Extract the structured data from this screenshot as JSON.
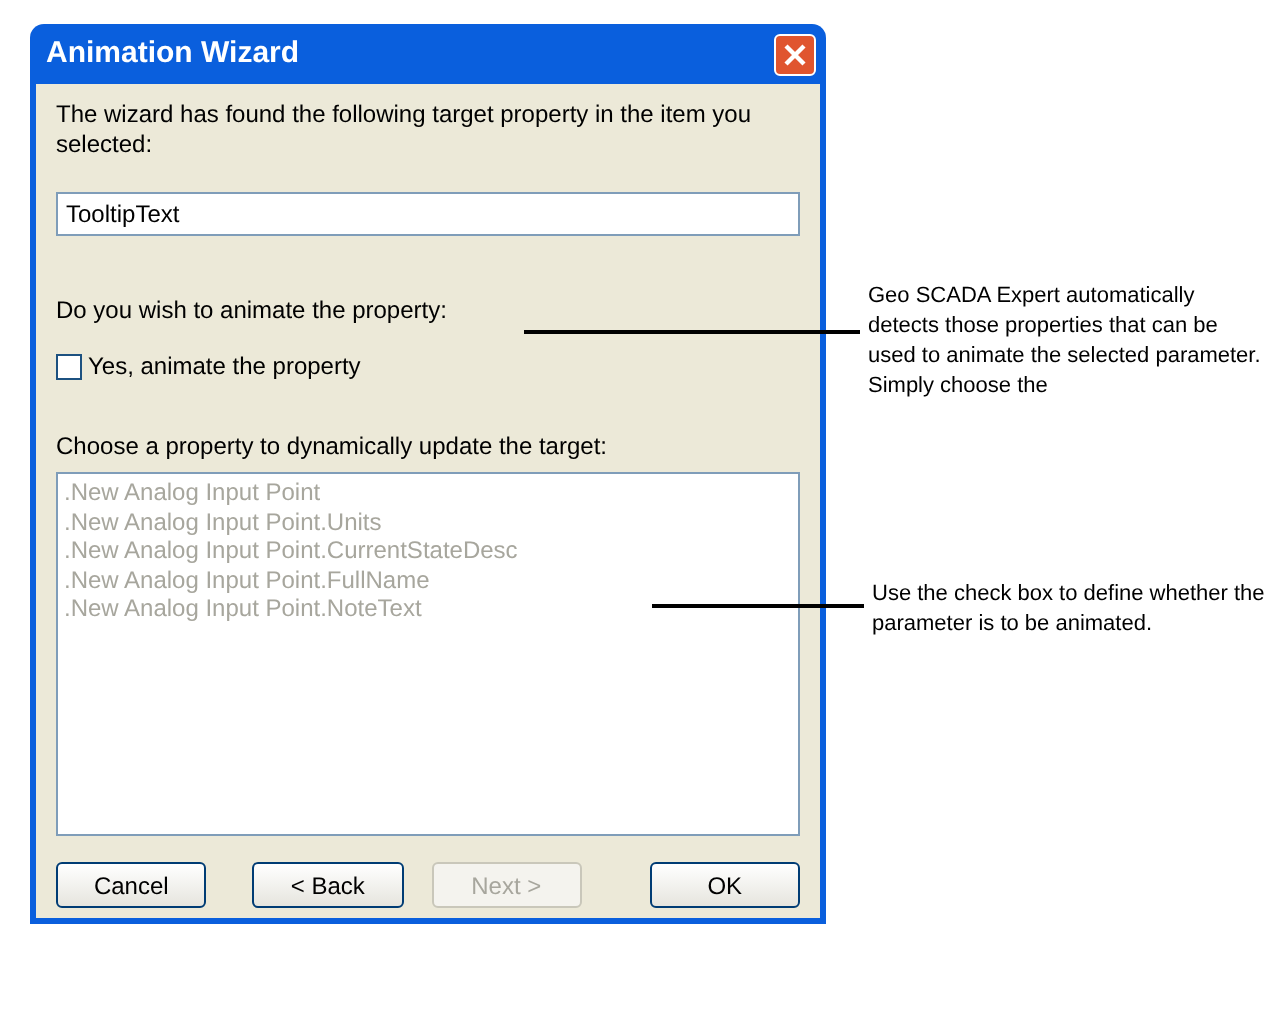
{
  "window": {
    "title": "Animation Wizard"
  },
  "intro": "The wizard has found the following target property in the item you selected:",
  "target_property": {
    "value": "TooltipText"
  },
  "animate_question": "Do you wish to animate the property:",
  "animate_checkbox": {
    "label": "Yes, animate the property",
    "checked": false
  },
  "choose_label": "Choose a property to dynamically update the target:",
  "property_list": {
    "disabled": true,
    "items": [
      {
        "label": ".New Analog Input Point"
      },
      {
        "label": ".New Analog Input Point.Units"
      },
      {
        "label": ".New Analog Input Point.CurrentStateDesc"
      },
      {
        "label": ".New Analog Input Point.FullName"
      },
      {
        "label": ".New Analog Input Point.NoteText"
      }
    ]
  },
  "buttons": [
    {
      "label": "Cancel",
      "disabled": false
    },
    {
      "label": "< Back",
      "disabled": false
    },
    {
      "label": "Next >",
      "disabled": true
    },
    {
      "label": "OK",
      "disabled": false
    }
  ],
  "callouts": [
    {
      "text": "Geo SCADA Expert automatically detects those properties that can be used to animate the selected parameter. Simply choose the"
    },
    {
      "text": "Use the check box to define whether the parameter is to be animated."
    }
  ]
}
